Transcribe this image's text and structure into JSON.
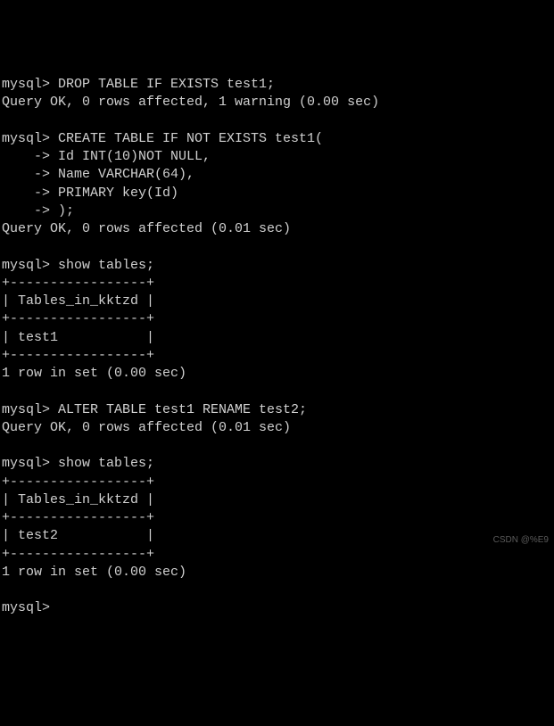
{
  "lines": [
    "mysql> DROP TABLE IF EXISTS test1;",
    "Query OK, 0 rows affected, 1 warning (0.00 sec)",
    "",
    "mysql> CREATE TABLE IF NOT EXISTS test1(",
    "    -> Id INT(10)NOT NULL,",
    "    -> Name VARCHAR(64),",
    "    -> PRIMARY key(Id)",
    "    -> );",
    "Query OK, 0 rows affected (0.01 sec)",
    "",
    "mysql> show tables;",
    "+-----------------+",
    "| Tables_in_kktzd |",
    "+-----------------+",
    "| test1           |",
    "+-----------------+",
    "1 row in set (0.00 sec)",
    "",
    "mysql> ALTER TABLE test1 RENAME test2;",
    "Query OK, 0 rows affected (0.01 sec)",
    "",
    "mysql> show tables;",
    "+-----------------+",
    "| Tables_in_kktzd |",
    "+-----------------+",
    "| test2           |",
    "+-----------------+",
    "1 row in set (0.00 sec)",
    "",
    "mysql> "
  ],
  "watermark": "CSDN @%E9"
}
